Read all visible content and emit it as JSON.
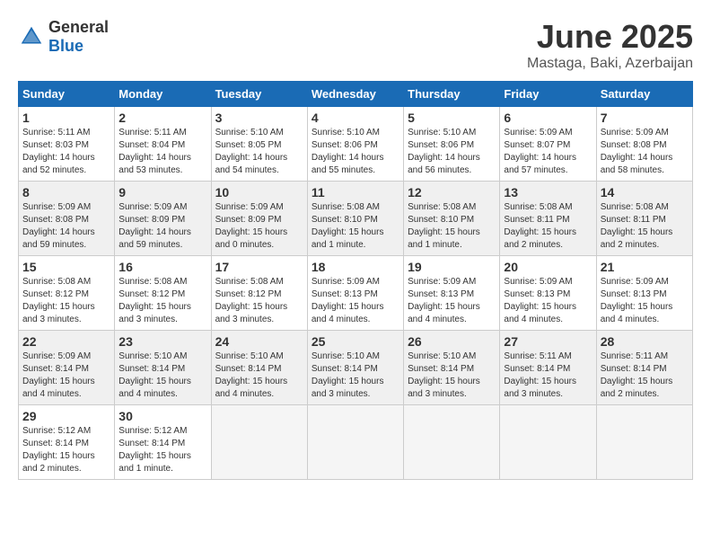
{
  "logo": {
    "text_general": "General",
    "text_blue": "Blue"
  },
  "title": "June 2025",
  "location": "Mastaga, Baki, Azerbaijan",
  "weekdays": [
    "Sunday",
    "Monday",
    "Tuesday",
    "Wednesday",
    "Thursday",
    "Friday",
    "Saturday"
  ],
  "weeks": [
    [
      {
        "day": "1",
        "info": "Sunrise: 5:11 AM\nSunset: 8:03 PM\nDaylight: 14 hours\nand 52 minutes."
      },
      {
        "day": "2",
        "info": "Sunrise: 5:11 AM\nSunset: 8:04 PM\nDaylight: 14 hours\nand 53 minutes."
      },
      {
        "day": "3",
        "info": "Sunrise: 5:10 AM\nSunset: 8:05 PM\nDaylight: 14 hours\nand 54 minutes."
      },
      {
        "day": "4",
        "info": "Sunrise: 5:10 AM\nSunset: 8:06 PM\nDaylight: 14 hours\nand 55 minutes."
      },
      {
        "day": "5",
        "info": "Sunrise: 5:10 AM\nSunset: 8:06 PM\nDaylight: 14 hours\nand 56 minutes."
      },
      {
        "day": "6",
        "info": "Sunrise: 5:09 AM\nSunset: 8:07 PM\nDaylight: 14 hours\nand 57 minutes."
      },
      {
        "day": "7",
        "info": "Sunrise: 5:09 AM\nSunset: 8:08 PM\nDaylight: 14 hours\nand 58 minutes."
      }
    ],
    [
      {
        "day": "8",
        "info": "Sunrise: 5:09 AM\nSunset: 8:08 PM\nDaylight: 14 hours\nand 59 minutes."
      },
      {
        "day": "9",
        "info": "Sunrise: 5:09 AM\nSunset: 8:09 PM\nDaylight: 14 hours\nand 59 minutes."
      },
      {
        "day": "10",
        "info": "Sunrise: 5:09 AM\nSunset: 8:09 PM\nDaylight: 15 hours\nand 0 minutes."
      },
      {
        "day": "11",
        "info": "Sunrise: 5:08 AM\nSunset: 8:10 PM\nDaylight: 15 hours\nand 1 minute."
      },
      {
        "day": "12",
        "info": "Sunrise: 5:08 AM\nSunset: 8:10 PM\nDaylight: 15 hours\nand 1 minute."
      },
      {
        "day": "13",
        "info": "Sunrise: 5:08 AM\nSunset: 8:11 PM\nDaylight: 15 hours\nand 2 minutes."
      },
      {
        "day": "14",
        "info": "Sunrise: 5:08 AM\nSunset: 8:11 PM\nDaylight: 15 hours\nand 2 minutes."
      }
    ],
    [
      {
        "day": "15",
        "info": "Sunrise: 5:08 AM\nSunset: 8:12 PM\nDaylight: 15 hours\nand 3 minutes."
      },
      {
        "day": "16",
        "info": "Sunrise: 5:08 AM\nSunset: 8:12 PM\nDaylight: 15 hours\nand 3 minutes."
      },
      {
        "day": "17",
        "info": "Sunrise: 5:08 AM\nSunset: 8:12 PM\nDaylight: 15 hours\nand 3 minutes."
      },
      {
        "day": "18",
        "info": "Sunrise: 5:09 AM\nSunset: 8:13 PM\nDaylight: 15 hours\nand 4 minutes."
      },
      {
        "day": "19",
        "info": "Sunrise: 5:09 AM\nSunset: 8:13 PM\nDaylight: 15 hours\nand 4 minutes."
      },
      {
        "day": "20",
        "info": "Sunrise: 5:09 AM\nSunset: 8:13 PM\nDaylight: 15 hours\nand 4 minutes."
      },
      {
        "day": "21",
        "info": "Sunrise: 5:09 AM\nSunset: 8:13 PM\nDaylight: 15 hours\nand 4 minutes."
      }
    ],
    [
      {
        "day": "22",
        "info": "Sunrise: 5:09 AM\nSunset: 8:14 PM\nDaylight: 15 hours\nand 4 minutes."
      },
      {
        "day": "23",
        "info": "Sunrise: 5:10 AM\nSunset: 8:14 PM\nDaylight: 15 hours\nand 4 minutes."
      },
      {
        "day": "24",
        "info": "Sunrise: 5:10 AM\nSunset: 8:14 PM\nDaylight: 15 hours\nand 4 minutes."
      },
      {
        "day": "25",
        "info": "Sunrise: 5:10 AM\nSunset: 8:14 PM\nDaylight: 15 hours\nand 3 minutes."
      },
      {
        "day": "26",
        "info": "Sunrise: 5:10 AM\nSunset: 8:14 PM\nDaylight: 15 hours\nand 3 minutes."
      },
      {
        "day": "27",
        "info": "Sunrise: 5:11 AM\nSunset: 8:14 PM\nDaylight: 15 hours\nand 3 minutes."
      },
      {
        "day": "28",
        "info": "Sunrise: 5:11 AM\nSunset: 8:14 PM\nDaylight: 15 hours\nand 2 minutes."
      }
    ],
    [
      {
        "day": "29",
        "info": "Sunrise: 5:12 AM\nSunset: 8:14 PM\nDaylight: 15 hours\nand 2 minutes."
      },
      {
        "day": "30",
        "info": "Sunrise: 5:12 AM\nSunset: 8:14 PM\nDaylight: 15 hours\nand 1 minute."
      },
      {
        "day": "",
        "info": ""
      },
      {
        "day": "",
        "info": ""
      },
      {
        "day": "",
        "info": ""
      },
      {
        "day": "",
        "info": ""
      },
      {
        "day": "",
        "info": ""
      }
    ]
  ]
}
